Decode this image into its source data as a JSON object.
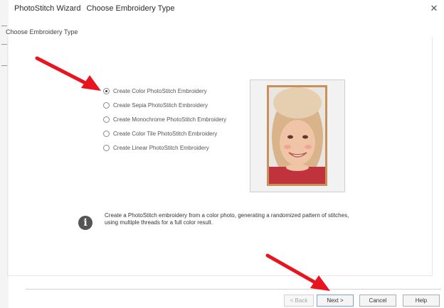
{
  "window": {
    "title_app": "PhotoStitch Wizard",
    "title_page": "Choose Embroidery Type",
    "close_glyph": "✕"
  },
  "group_label": "Choose Embroidery Type",
  "options": [
    {
      "label": "Create Color PhotoStitch Embroidery",
      "checked": true
    },
    {
      "label": "Create Sepia PhotoStitch Embroidery",
      "checked": false
    },
    {
      "label": "Create Monochrome PhotoStitch Embroidery",
      "checked": false
    },
    {
      "label": "Create Color Tile PhotoStitch Embroidery",
      "checked": false
    },
    {
      "label": "Create Linear PhotoStitch Embroidery",
      "checked": false
    }
  ],
  "info": {
    "icon": "info-icon",
    "icon_glyph": "i",
    "text": "Create a PhotoStitch embroidery from a color photo, generating a randomized pattern of stitches, using multiple threads for a full color result."
  },
  "buttons": {
    "back": "< Back",
    "next": "Next >",
    "cancel": "Cancel",
    "help": "Help"
  },
  "colors": {
    "arrow": "#e8141e",
    "photo_frame": "#c9905a"
  }
}
